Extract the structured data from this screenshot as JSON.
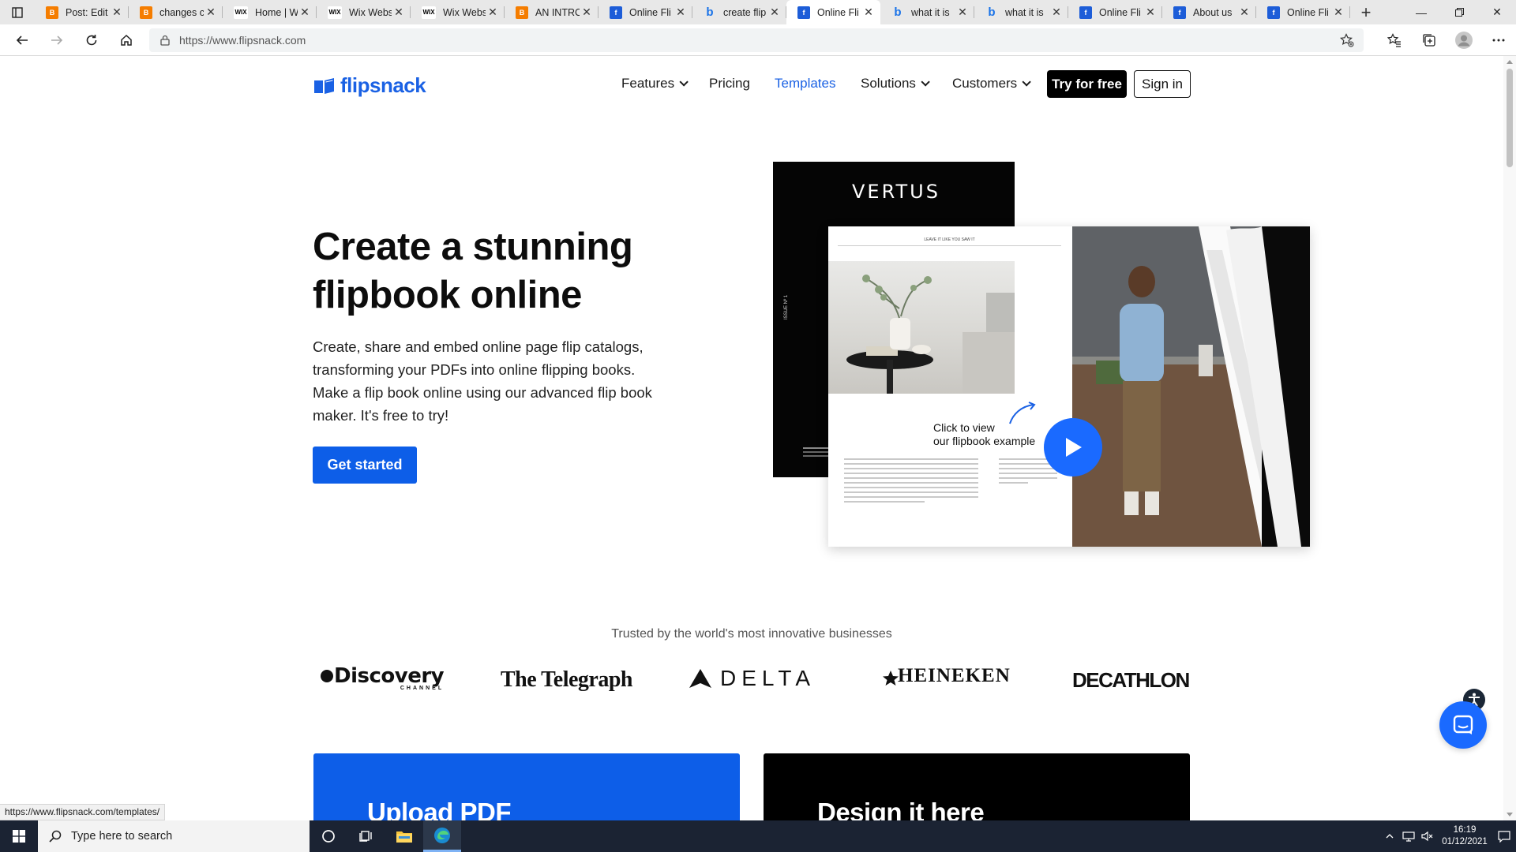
{
  "browser": {
    "tabs": [
      {
        "favicon": "blogger",
        "title": "Post: Edit"
      },
      {
        "favicon": "blogger",
        "title": "changes c"
      },
      {
        "favicon": "wix",
        "title": "Home | W"
      },
      {
        "favicon": "wix",
        "title": "Wix Webs"
      },
      {
        "favicon": "wix",
        "title": "Wix Webs"
      },
      {
        "favicon": "blogger",
        "title": "AN INTRC"
      },
      {
        "favicon": "flipsnack",
        "title": "Online Fli"
      },
      {
        "favicon": "bing",
        "title": "create flip"
      },
      {
        "favicon": "flipsnack",
        "title": "Online Fli",
        "active": true
      },
      {
        "favicon": "bing",
        "title": "what it is"
      },
      {
        "favicon": "bing",
        "title": "what it is"
      },
      {
        "favicon": "flipsnack",
        "title": "Online Fli"
      },
      {
        "favicon": "flipsnack",
        "title": "About us"
      },
      {
        "favicon": "flipsnack",
        "title": "Online Fli"
      }
    ],
    "url": "https://www.flipsnack.com",
    "status_url": "https://www.flipsnack.com/templates/"
  },
  "site": {
    "logo_text": "flipsnack",
    "nav": {
      "features": "Features",
      "pricing": "Pricing",
      "templates": "Templates",
      "solutions": "Solutions",
      "customers": "Customers",
      "try_free": "Try for free",
      "sign_in": "Sign in"
    },
    "hero": {
      "title_line1": "Create a stunning",
      "title_line2": "flipbook online",
      "description": "Create, share and embed online page flip catalogs, transforming your PDFs into online flipping books. Make a flip book online using our advanced flip book maker. It's free to try!",
      "cta": "Get started"
    },
    "flipbook": {
      "cover_brand": "VERTUS",
      "cover_issue": "ISSUE Nº 1",
      "page_header": "LEAVE IT LIKE YOU SAW IT",
      "cta_line1": "Click to view",
      "cta_line2": "our flipbook example"
    },
    "trusted": {
      "text": "Trusted by the world's most innovative businesses",
      "logos": [
        "Discovery",
        "CHANNEL",
        "The Telegraph",
        "DELTA",
        "HEINEKEN",
        "DECATHLON"
      ]
    },
    "cards": {
      "upload": "Upload PDF",
      "design": "Design it here"
    },
    "colors": {
      "brand_blue": "#1a61e4",
      "cta_blue": "#0d5ee8"
    }
  },
  "taskbar": {
    "search_placeholder": "Type here to search",
    "time": "16:19",
    "date": "01/12/2021"
  }
}
